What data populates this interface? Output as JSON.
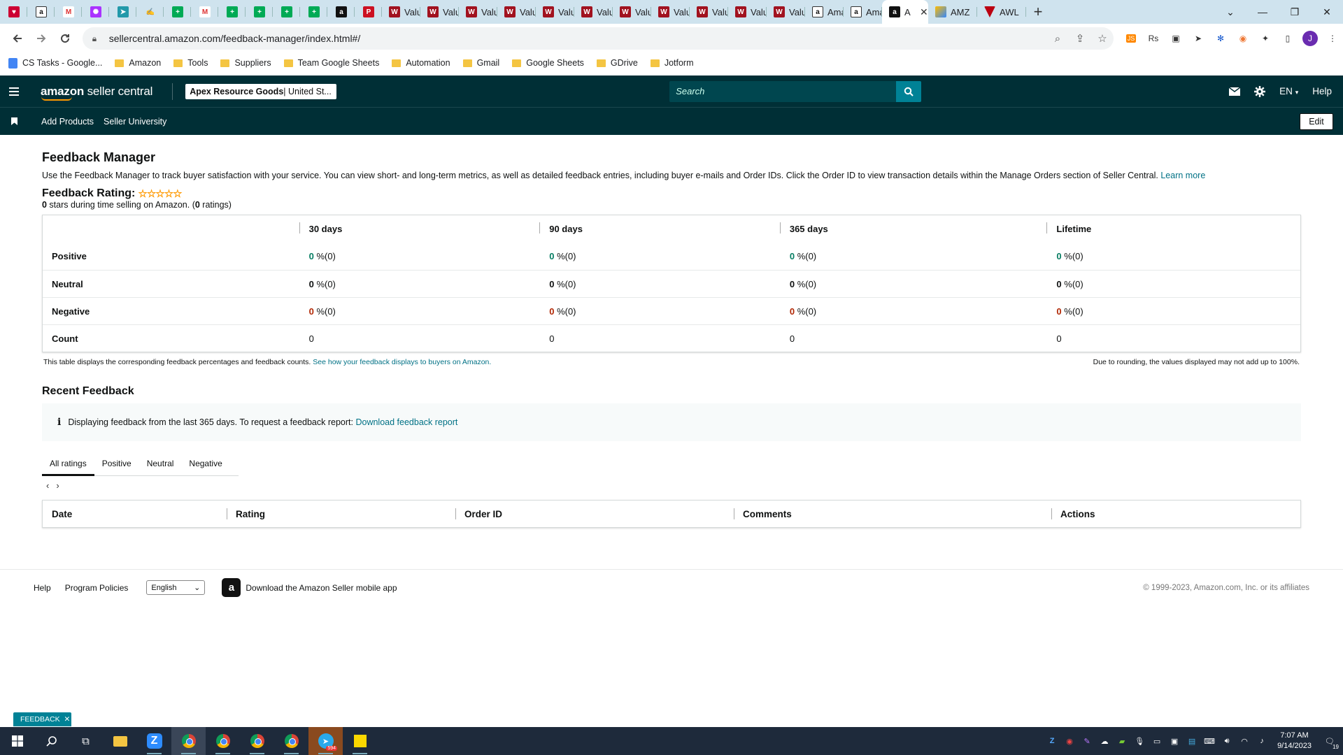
{
  "browser": {
    "tabs": [
      {
        "title": "",
        "icon": "heart-icon",
        "color": "#c03"
      },
      {
        "title": "",
        "icon": "amazon-icon",
        "color": "#fff"
      },
      {
        "title": "",
        "icon": "gmail-icon",
        "color": "#fff"
      },
      {
        "title": "",
        "icon": "messenger-icon",
        "color": "#a3f"
      },
      {
        "title": "",
        "icon": "telegram-icon",
        "color": "#29a"
      },
      {
        "title": "",
        "icon": "signature-icon",
        "color": "#bbb"
      },
      {
        "title": "",
        "icon": "sheets-icon",
        "color": "#0a5"
      },
      {
        "title": "",
        "icon": "gmail-icon",
        "color": "#fff"
      },
      {
        "title": "",
        "icon": "sheets-icon",
        "color": "#0a5"
      },
      {
        "title": "",
        "icon": "sheets-icon",
        "color": "#0a5"
      },
      {
        "title": "",
        "icon": "sheets-icon",
        "color": "#0a5"
      },
      {
        "title": "",
        "icon": "sheets-icon",
        "color": "#0a5"
      },
      {
        "title": "",
        "icon": "amazon-icon",
        "color": "#111"
      },
      {
        "title": "",
        "icon": "pinterest-icon",
        "color": "#c12"
      }
    ],
    "normal_tabs": [
      {
        "title": "Valu",
        "icon": "vw-icon"
      },
      {
        "title": "Valu",
        "icon": "vw-icon"
      },
      {
        "title": "Valu",
        "icon": "vw-icon"
      },
      {
        "title": "Valu",
        "icon": "vw-icon"
      },
      {
        "title": "Valu",
        "icon": "vw-icon"
      },
      {
        "title": "Valu",
        "icon": "vw-icon"
      },
      {
        "title": "Valu",
        "icon": "vw-icon"
      },
      {
        "title": "Valu",
        "icon": "vw-icon"
      },
      {
        "title": "Valu",
        "icon": "vw-icon"
      },
      {
        "title": "Valu",
        "icon": "vw-icon"
      },
      {
        "title": "Valu",
        "icon": "vw-icon"
      },
      {
        "title": "Ama",
        "icon": "amazon-icon"
      },
      {
        "title": "Ama",
        "icon": "amazon-icon"
      }
    ],
    "active_tab": {
      "title": "A",
      "icon": "amazon-icon"
    },
    "trailing_tabs": [
      {
        "title": "AMZ",
        "icon": "pen-icon"
      },
      {
        "title": "AWL",
        "icon": "vw-icon"
      }
    ],
    "url": "sellercentral.amazon.com/feedback-manager/index.html#/",
    "avatar_letter": "J",
    "bookmarks": [
      {
        "label": "CS Tasks - Google...",
        "type": "doc"
      },
      {
        "label": "Amazon",
        "type": "folder"
      },
      {
        "label": "Tools",
        "type": "folder"
      },
      {
        "label": "Suppliers",
        "type": "folder"
      },
      {
        "label": "Team Google Sheets",
        "type": "folder"
      },
      {
        "label": "Automation",
        "type": "folder"
      },
      {
        "label": "Gmail",
        "type": "folder"
      },
      {
        "label": "Google Sheets",
        "type": "folder"
      },
      {
        "label": "GDrive",
        "type": "folder"
      },
      {
        "label": "Jotform",
        "type": "folder"
      }
    ]
  },
  "header": {
    "logo_text_bold": "amazon",
    "logo_text": " seller central",
    "store_name": "Apex Resource Goods",
    "store_marketplace": " | United St...",
    "search_placeholder": "Search",
    "language": "EN",
    "help_label": "Help"
  },
  "nav": {
    "links": [
      "Add Products",
      "Seller University"
    ],
    "edit_label": "Edit"
  },
  "page": {
    "title": "Feedback Manager",
    "description": "Use the Feedback Manager to track buyer satisfaction with your service. You can view short- and long-term metrics, as well as detailed feedback entries, including buyer e-mails and Order IDs. Click the Order ID to view transaction details within the Manage Orders section of Seller Central.",
    "learn_more": "Learn more",
    "rating_label": "Feedback Rating:",
    "rating_stars": 0,
    "rating_sub_count": "0",
    "rating_sub_text": " stars during time selling on Amazon. (",
    "rating_sub_ratings": "0",
    "rating_sub_end": " ratings)"
  },
  "metrics": {
    "columns": [
      "30 days",
      "90 days",
      "365 days",
      "Lifetime"
    ],
    "rows": [
      {
        "label": "Positive",
        "style": "g",
        "cells": [
          {
            "num": "0",
            "rest": " %(0)"
          },
          {
            "num": "0",
            "rest": " %(0)"
          },
          {
            "num": "0",
            "rest": " %(0)"
          },
          {
            "num": "0",
            "rest": " %(0)"
          }
        ]
      },
      {
        "label": "Neutral",
        "style": "n",
        "cells": [
          {
            "num": "0",
            "rest": " %(0)"
          },
          {
            "num": "0",
            "rest": " %(0)"
          },
          {
            "num": "0",
            "rest": " %(0)"
          },
          {
            "num": "0",
            "rest": " %(0)"
          }
        ]
      },
      {
        "label": "Negative",
        "style": "r",
        "cells": [
          {
            "num": "0",
            "rest": " %(0)"
          },
          {
            "num": "0",
            "rest": " %(0)"
          },
          {
            "num": "0",
            "rest": " %(0)"
          },
          {
            "num": "0",
            "rest": " %(0)"
          }
        ]
      },
      {
        "label": "Count",
        "style": "",
        "cells": [
          {
            "num": "0",
            "rest": ""
          },
          {
            "num": "0",
            "rest": ""
          },
          {
            "num": "0",
            "rest": ""
          },
          {
            "num": "0",
            "rest": ""
          }
        ]
      }
    ],
    "note_left": "This table displays the corresponding feedback percentages and feedback counts.",
    "note_link": "See how your feedback displays to buyers on Amazon.",
    "note_right": "Due to rounding, the values displayed may not add up to 100%."
  },
  "recent": {
    "title": "Recent Feedback",
    "info_text": "Displaying feedback from the last 365 days. To request a feedback report:",
    "info_link": "Download feedback report",
    "tabs": [
      "All ratings",
      "Positive",
      "Neutral",
      "Negative"
    ],
    "selected_tab": "All ratings",
    "table_columns": [
      "Date",
      "Rating",
      "Order ID",
      "Comments",
      "Actions"
    ]
  },
  "footer": {
    "links": [
      "Help",
      "Program Policies"
    ],
    "language": "English",
    "app_text": "Download the Amazon Seller mobile app",
    "copyright": "© 1999-2023, Amazon.com, Inc. or its affiliates",
    "feedback_tab": "FEEDBACK"
  },
  "taskbar": {
    "time": "7:07 AM",
    "date": "9/14/2023",
    "telegram_badge": "594",
    "notification_count": "19"
  },
  "colors": {
    "header_bg": "#002f36",
    "accent": "#008296",
    "positive": "#067d62",
    "negative": "#b12704",
    "link": "#007185"
  }
}
